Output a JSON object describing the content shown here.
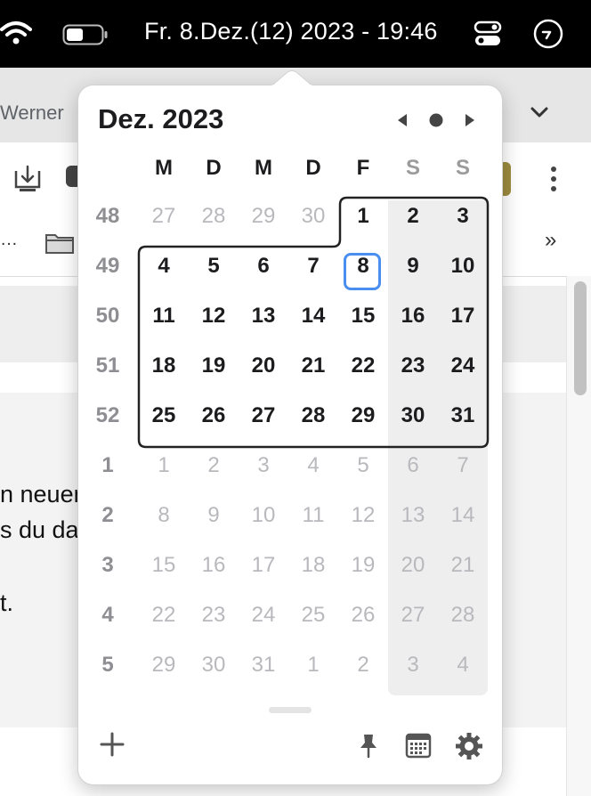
{
  "menubar": {
    "clock": "Fr. 8.Dez.(12) 2023 - 19:46",
    "icons": [
      "wifi-icon",
      "battery-icon",
      "control-center-icon",
      "extension-icon"
    ]
  },
  "browser": {
    "tab_text": "Werner",
    "bookmarks_ellipsis": "…",
    "bookmarks_more": "»",
    "body_lines": [
      "n neuen",
      "s du da",
      "t."
    ],
    "icons": [
      "chevron-down-icon",
      "download-icon",
      "more-vertical-icon",
      "folder-icon"
    ]
  },
  "calendar": {
    "title": "Dez. 2023",
    "weekday_headers": [
      "M",
      "D",
      "M",
      "D",
      "F",
      "S",
      "S"
    ],
    "weeks": [
      {
        "week": "48",
        "days": [
          {
            "d": "27",
            "cur": false
          },
          {
            "d": "28",
            "cur": false
          },
          {
            "d": "29",
            "cur": false
          },
          {
            "d": "30",
            "cur": false
          },
          {
            "d": "1",
            "cur": true
          },
          {
            "d": "2",
            "cur": true
          },
          {
            "d": "3",
            "cur": true
          }
        ]
      },
      {
        "week": "49",
        "days": [
          {
            "d": "4",
            "cur": true
          },
          {
            "d": "5",
            "cur": true
          },
          {
            "d": "6",
            "cur": true
          },
          {
            "d": "7",
            "cur": true
          },
          {
            "d": "8",
            "cur": true,
            "today": true
          },
          {
            "d": "9",
            "cur": true
          },
          {
            "d": "10",
            "cur": true
          }
        ]
      },
      {
        "week": "50",
        "days": [
          {
            "d": "11",
            "cur": true
          },
          {
            "d": "12",
            "cur": true
          },
          {
            "d": "13",
            "cur": true
          },
          {
            "d": "14",
            "cur": true
          },
          {
            "d": "15",
            "cur": true
          },
          {
            "d": "16",
            "cur": true
          },
          {
            "d": "17",
            "cur": true
          }
        ]
      },
      {
        "week": "51",
        "days": [
          {
            "d": "18",
            "cur": true
          },
          {
            "d": "19",
            "cur": true
          },
          {
            "d": "20",
            "cur": true
          },
          {
            "d": "21",
            "cur": true
          },
          {
            "d": "22",
            "cur": true
          },
          {
            "d": "23",
            "cur": true
          },
          {
            "d": "24",
            "cur": true
          }
        ]
      },
      {
        "week": "52",
        "days": [
          {
            "d": "25",
            "cur": true
          },
          {
            "d": "26",
            "cur": true
          },
          {
            "d": "27",
            "cur": true
          },
          {
            "d": "28",
            "cur": true
          },
          {
            "d": "29",
            "cur": true
          },
          {
            "d": "30",
            "cur": true
          },
          {
            "d": "31",
            "cur": true
          }
        ]
      },
      {
        "week": "1",
        "days": [
          {
            "d": "1",
            "cur": false
          },
          {
            "d": "2",
            "cur": false
          },
          {
            "d": "3",
            "cur": false
          },
          {
            "d": "4",
            "cur": false
          },
          {
            "d": "5",
            "cur": false
          },
          {
            "d": "6",
            "cur": false
          },
          {
            "d": "7",
            "cur": false
          }
        ]
      },
      {
        "week": "2",
        "days": [
          {
            "d": "8",
            "cur": false
          },
          {
            "d": "9",
            "cur": false
          },
          {
            "d": "10",
            "cur": false
          },
          {
            "d": "11",
            "cur": false
          },
          {
            "d": "12",
            "cur": false
          },
          {
            "d": "13",
            "cur": false
          },
          {
            "d": "14",
            "cur": false
          }
        ]
      },
      {
        "week": "3",
        "days": [
          {
            "d": "15",
            "cur": false
          },
          {
            "d": "16",
            "cur": false
          },
          {
            "d": "17",
            "cur": false
          },
          {
            "d": "18",
            "cur": false
          },
          {
            "d": "19",
            "cur": false
          },
          {
            "d": "20",
            "cur": false
          },
          {
            "d": "21",
            "cur": false
          }
        ]
      },
      {
        "week": "4",
        "days": [
          {
            "d": "22",
            "cur": false
          },
          {
            "d": "23",
            "cur": false
          },
          {
            "d": "24",
            "cur": false
          },
          {
            "d": "25",
            "cur": false
          },
          {
            "d": "26",
            "cur": false
          },
          {
            "d": "27",
            "cur": false
          },
          {
            "d": "28",
            "cur": false
          }
        ]
      },
      {
        "week": "5",
        "days": [
          {
            "d": "29",
            "cur": false
          },
          {
            "d": "30",
            "cur": false
          },
          {
            "d": "31",
            "cur": false
          },
          {
            "d": "1",
            "cur": false
          },
          {
            "d": "2",
            "cur": false
          },
          {
            "d": "3",
            "cur": false
          },
          {
            "d": "4",
            "cur": false
          }
        ]
      }
    ],
    "nav_icons": [
      "chevron-left-icon",
      "today-dot-icon",
      "chevron-right-icon"
    ],
    "footer_icons": [
      "plus-icon",
      "pin-icon",
      "calendar-icon",
      "gear-icon"
    ]
  },
  "colors": {
    "menubar": "#000000",
    "today_ring": "#4a8ff0",
    "weekend_column": "#eeeeee",
    "other_month_text": "#b9b9bd",
    "week_number_text": "#8e8e93"
  }
}
